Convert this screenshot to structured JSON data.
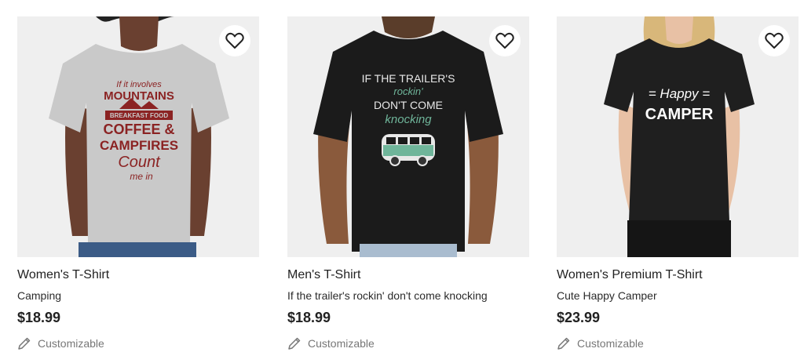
{
  "products": [
    {
      "type": "Women's T-Shirt",
      "name": "Camping",
      "price": "$18.99",
      "customizable": "Customizable",
      "shirt_color": "#c9c9c9",
      "print_color": "#8b2323",
      "print_lines": [
        "If it involves",
        "MOUNTAINS",
        "BREAKFAST FOOD",
        "COFFEE &",
        "CAMPFIRES",
        "Count",
        "me in"
      ]
    },
    {
      "type": "Men's T-Shirt",
      "name": "If the trailer's rockin' don't come knocking",
      "price": "$18.99",
      "customizable": "Customizable",
      "shirt_color": "#1b1b1b",
      "print_color": "#e8e8e8",
      "accent_color": "#6fb59a",
      "print_lines": [
        "IF THE TRAILER'S",
        "rockin'",
        "DON'T COME",
        "knocking"
      ]
    },
    {
      "type": "Women's Premium T-Shirt",
      "name": "Cute Happy Camper",
      "price": "$23.99",
      "customizable": "Customizable",
      "shirt_color": "#1f1f1f",
      "print_color": "#ffffff",
      "print_lines": [
        "= Happy =",
        "CAMPER"
      ]
    }
  ]
}
